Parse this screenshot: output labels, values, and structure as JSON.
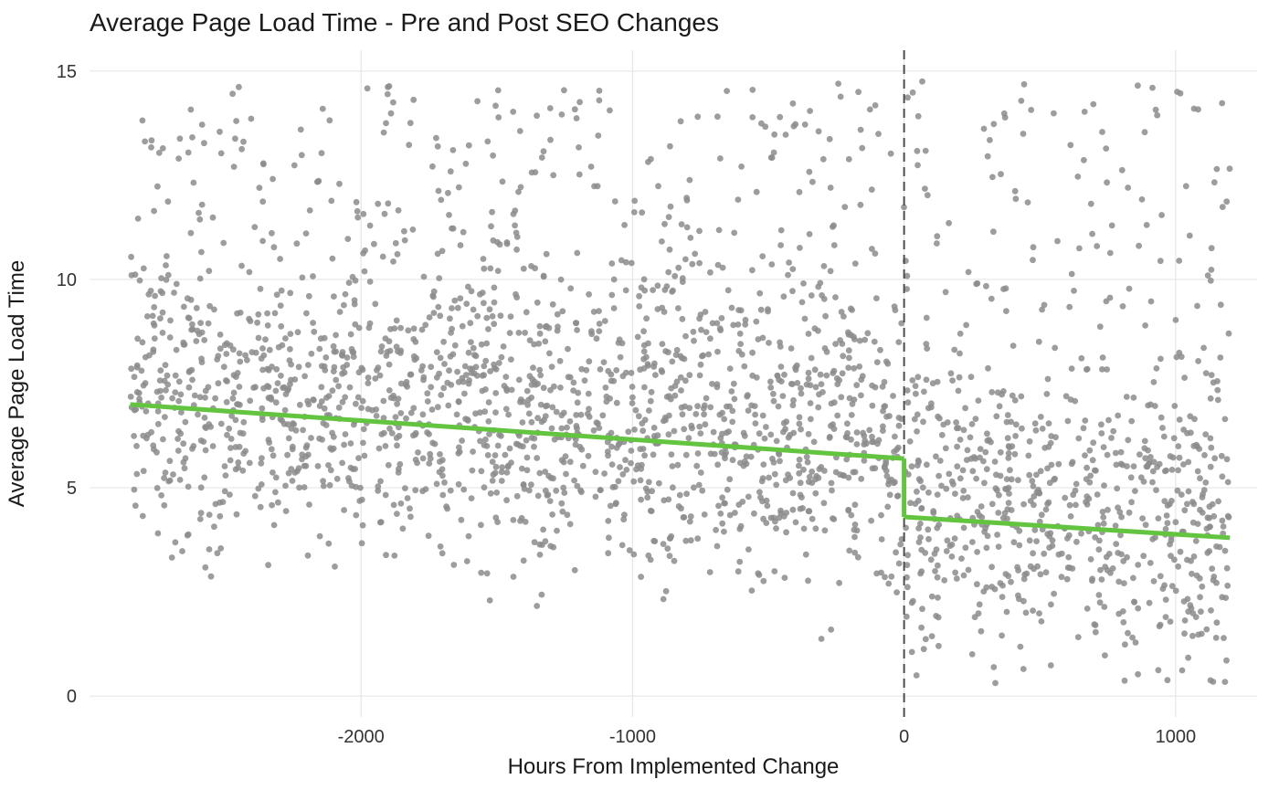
{
  "chart_data": {
    "type": "scatter",
    "title": "Average Page Load Time - Pre and Post SEO Changes",
    "xlabel": "Hours From Implemented Change",
    "ylabel": "Average Page Load Time",
    "xlim": [
      -3000,
      1300
    ],
    "ylim": [
      -0.5,
      15.5
    ],
    "x_ticks": [
      -2000,
      -1000,
      0,
      1000
    ],
    "y_ticks": [
      0,
      5,
      10,
      15
    ],
    "reference_vline_x": 0,
    "series": [
      {
        "name": "points",
        "kind": "scatter_cloud",
        "x_range": [
          -2850,
          1200
        ],
        "y_range": [
          0.3,
          15.0
        ],
        "n_points": 2600,
        "density_note": "Uniform horizontal density; vertical distribution skewed toward low values with long upper tail; slightly lower mean for x>0."
      },
      {
        "name": "trend_pre",
        "kind": "line",
        "x": [
          -2850,
          0
        ],
        "y": [
          7.0,
          5.7
        ]
      },
      {
        "name": "trend_post",
        "kind": "line",
        "x": [
          0,
          1200
        ],
        "y": [
          4.3,
          3.8
        ]
      }
    ]
  },
  "colors": {
    "points": "#8c8c8c",
    "trend": "#63c43f",
    "grid": "#e6e6e6",
    "vline": "#4d4d4d",
    "text": "#1a1a1a"
  }
}
